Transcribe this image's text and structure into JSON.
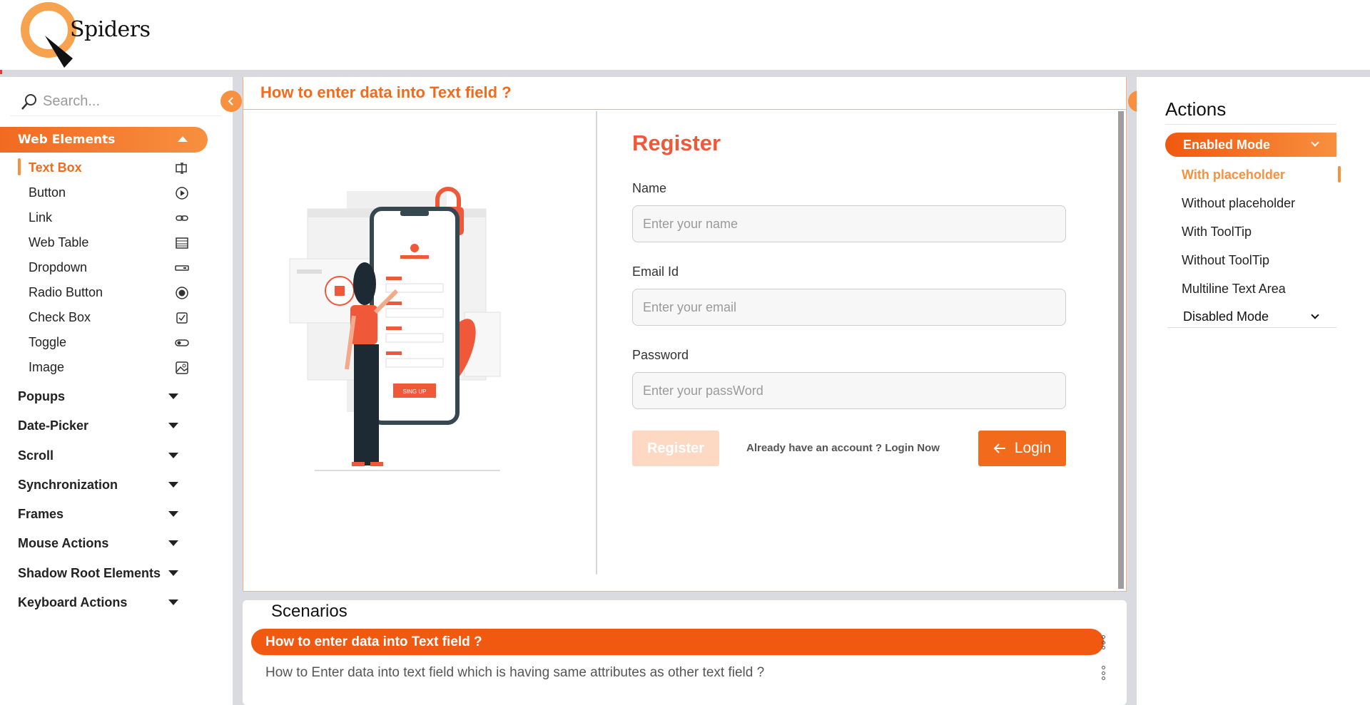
{
  "header": {
    "logo_text": "Spiders"
  },
  "search": {
    "placeholder": "Search..."
  },
  "sidebar": {
    "active_section": "Web Elements",
    "items": [
      {
        "label": "Text Box",
        "icon": "textbox-icon",
        "active": true
      },
      {
        "label": "Button",
        "icon": "play-circle-icon"
      },
      {
        "label": "Link",
        "icon": "link-icon"
      },
      {
        "label": "Web Table",
        "icon": "table-icon"
      },
      {
        "label": "Dropdown",
        "icon": "dropdown-icon"
      },
      {
        "label": "Radio Button",
        "icon": "radio-icon"
      },
      {
        "label": "Check Box",
        "icon": "checkbox-icon"
      },
      {
        "label": "Toggle",
        "icon": "toggle-icon"
      },
      {
        "label": "Image",
        "icon": "image-icon"
      }
    ],
    "sections": [
      "Popups",
      "Date-Picker",
      "Scroll",
      "Synchronization",
      "Frames",
      "Mouse Actions",
      "Shadow Root Elements",
      "Keyboard Actions"
    ]
  },
  "main": {
    "title": "How to enter data into Text field ?",
    "form": {
      "heading": "Register",
      "name_label": "Name",
      "name_placeholder": "Enter your name",
      "email_label": "Email Id",
      "email_placeholder": "Enter your email",
      "password_label": "Password",
      "password_placeholder": "Enter your passWord",
      "register_button": "Register",
      "already_text": "Already have an account ? Login Now",
      "login_button": "Login"
    },
    "illustration_button": "SING UP"
  },
  "scenarios": {
    "title": "Scenarios",
    "items": [
      "How to enter data into Text field ?",
      "How to Enter data into text field which is having same attributes as other text field ?"
    ]
  },
  "actions": {
    "title": "Actions",
    "enabled_mode": "Enabled Mode",
    "items": [
      "With placeholder",
      "Without placeholder",
      "With ToolTip",
      "Without ToolTip",
      "Multiline Text Area"
    ],
    "disabled_mode": "Disabled Mode"
  },
  "colors": {
    "accent": "#f26b1d",
    "accent_light": "#f7903f",
    "register_red": "#f0583a"
  }
}
